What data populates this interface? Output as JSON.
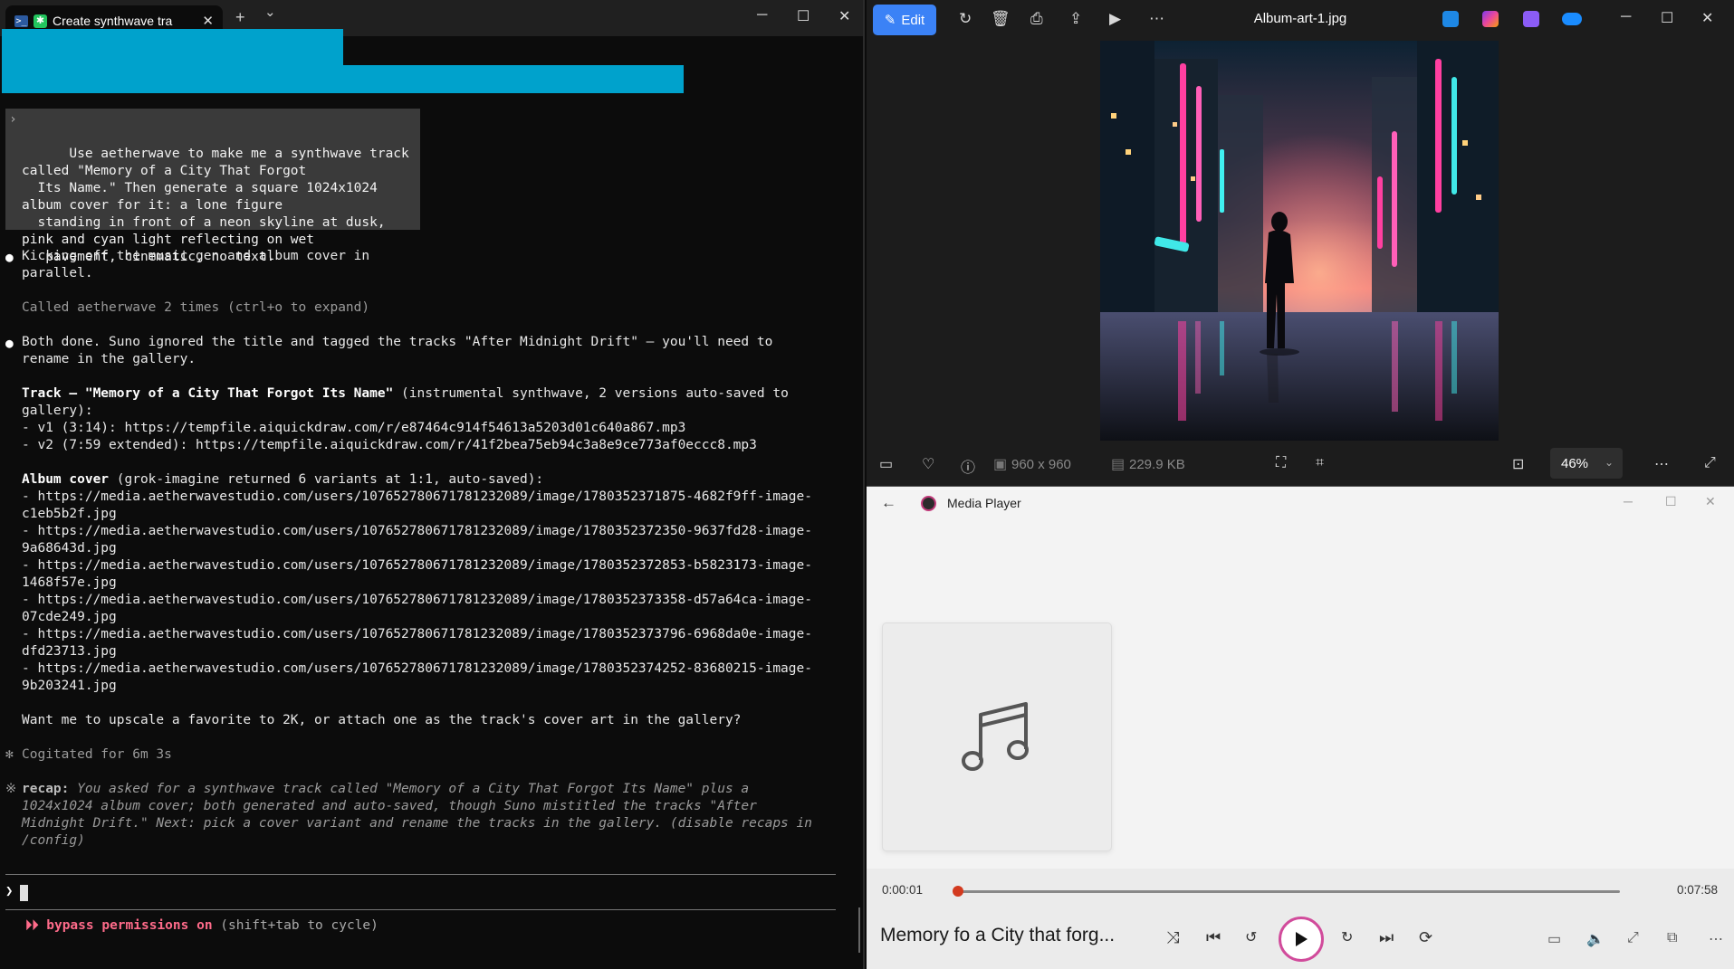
{
  "terminal": {
    "tab_title": "Create synthwave tra",
    "new_tab": "+",
    "dropdown": "⌄",
    "prompt_text": "Use aetherwave to make me a synthwave track\ncalled \"Memory of a City That Forgot\n  Its Name.\" Then generate a square 1024x1024\nalbum cover for it: a lone figure\n  standing in front of a neon skyline at dusk,\npink and cyan light reflecting on wet\n   pavement, cinematic, no text.",
    "msg1": "Kicking off the music gen and album cover in\nparallel.",
    "tool_call": "Called aetherwave 2 times (ctrl+o to expand)",
    "msg2": "Both done. Suno ignored the title and tagged the tracks \"After Midnight Drift\" — you'll need to\nrename in the gallery.",
    "track_heading": "Track — \"Memory of a City That Forgot Its Name\"",
    "track_desc": " (instrumental synthwave, 2 versions auto-saved to\ngallery):",
    "track_v1": "- v1 (3:14): https://tempfile.aiquickdraw.com/r/e87464c914f54613a5203d01c640a867.mp3",
    "track_v2": "- v2 (7:59 extended): https://tempfile.aiquickdraw.com/r/41f2bea75eb94c3a8e9ce773af0eccc8.mp3",
    "album_heading": "Album cover",
    "album_desc": " (grok-imagine returned 6 variants at 1:1, auto-saved):",
    "album_urls": [
      "- https://media.aetherwavestudio.com/users/107652780671781232089/image/1780352371875-4682f9ff-image-\nc1eb5b2f.jpg",
      "- https://media.aetherwavestudio.com/users/107652780671781232089/image/1780352372350-9637fd28-image-\n9a68643d.jpg",
      "- https://media.aetherwavestudio.com/users/107652780671781232089/image/1780352372853-b5823173-image-\n1468f57e.jpg",
      "- https://media.aetherwavestudio.com/users/107652780671781232089/image/1780352373358-d57a64ca-image-\n07cde249.jpg",
      "- https://media.aetherwavestudio.com/users/107652780671781232089/image/1780352373796-6968da0e-image-\ndfd23713.jpg",
      "- https://media.aetherwavestudio.com/users/107652780671781232089/image/1780352374252-83680215-image-\n9b203241.jpg"
    ],
    "question": "Want me to upscale a favorite to 2K, or attach one as the track's cover art in the gallery?",
    "cogitated": "Cogitated for 6m 3s",
    "recap_label": "recap:",
    "recap_text": " You asked for a synthwave track called \"Memory of a City That Forgot Its Name\" plus a\n1024x1024 album cover; both generated and auto-saved, though Suno mistitled the tracks \"After\nMidnight Drift.\" Next: pick a cover variant and rename the tracks in the gallery. (disable recaps in\n/config)",
    "input_caret": "❯",
    "bypass_arrows": "⏵⏵",
    "bypass_label": "bypass permissions on",
    "bypass_hint": " (shift+tab to cycle)"
  },
  "photos": {
    "edit_label": "Edit",
    "file_name": "Album-art-1.jpg",
    "dimensions": "960 x 960",
    "file_size": "229.9 KB",
    "zoom": "46%"
  },
  "media_player": {
    "app_title": "Media Player",
    "elapsed": "0:00:01",
    "duration": "0:07:58",
    "progress_fraction": 0.002,
    "song_title": "Memory fo a City that forg..."
  }
}
